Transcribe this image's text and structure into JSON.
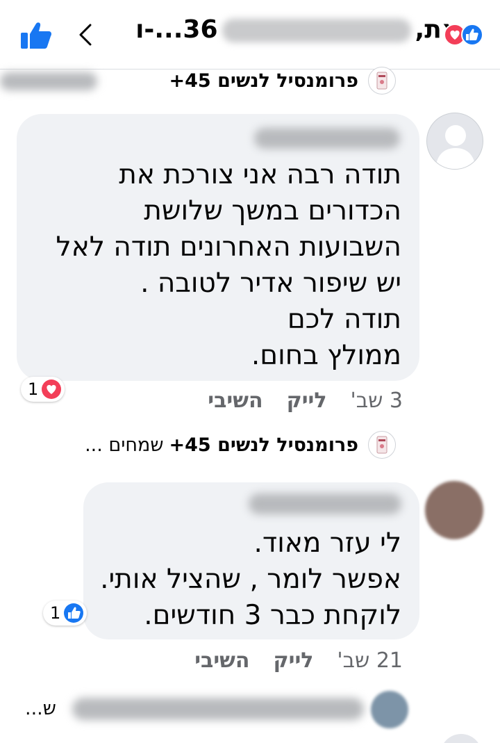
{
  "header": {
    "title_prefix": "36...-ו",
    "title_suffix": "את,",
    "reactions": [
      "heart-icon",
      "like-icon"
    ]
  },
  "top_page_row": {
    "page_name": "פרומנסיל לנשים 45+"
  },
  "comments": [
    {
      "text": "תודה רבה אני צורכת את\nהכדורים במשך שלושת\nהשבועות האחרונים תודה לאל\nיש שיפור אדיר לטובה .\nתודה לכם\nממולץ בחום.",
      "reaction_count": "1",
      "reaction": "heart",
      "time": "3 שב'",
      "like_label": "לייק",
      "reply_label": "השיבי"
    },
    {
      "text": "לי עזר מאוד.\nאפשר לומר , שהציל אותי.\nלוקחת כבר 3 חודשים.",
      "reaction_count": "1",
      "reaction": "like",
      "time": "21 שב'",
      "like_label": "לייק",
      "reply_label": "השיבי"
    }
  ],
  "reply_page_row": {
    "page_name": "פרומנסיל לנשים 45+",
    "extra": "שמחים ..."
  },
  "bottom_row": {
    "trailing": "ש..."
  },
  "colors": {
    "fb_blue": "#1877f2",
    "heart_red": "#f33e58",
    "bubble": "#f0f2f5",
    "meta": "#65676b"
  }
}
